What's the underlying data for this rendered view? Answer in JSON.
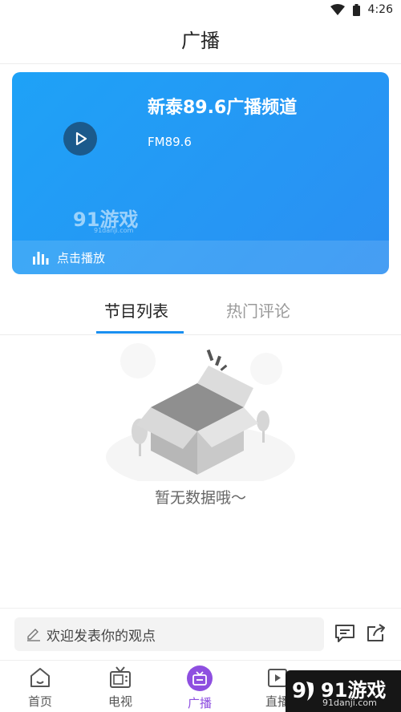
{
  "status_bar": {
    "time": "4:26",
    "icons": [
      "wifi-icon",
      "battery-icon"
    ]
  },
  "header": {
    "title": "广播"
  },
  "player": {
    "channel_name": "新泰89.6广播频道",
    "frequency": "FM89.6",
    "play_label": "点击播放",
    "watermark": "91游戏",
    "watermark_sub": "91danji.com",
    "colors": {
      "card_start": "#1ea2f7",
      "card_end": "#2b8ff2",
      "play_button": "#1b5a8c"
    }
  },
  "tabs": [
    {
      "label": "节目列表",
      "active": true
    },
    {
      "label": "热门评论",
      "active": false
    }
  ],
  "empty_state": {
    "message": "暂无数据哦～",
    "icon": "empty-box-icon"
  },
  "comment_bar": {
    "placeholder": "欢迎发表你的观点",
    "icons": [
      "pencil-icon",
      "chat-icon",
      "share-icon"
    ]
  },
  "nav": [
    {
      "label": "首页",
      "icon": "home-icon",
      "active": false
    },
    {
      "label": "电视",
      "icon": "tv-icon",
      "active": false
    },
    {
      "label": "广播",
      "icon": "radio-icon",
      "active": true
    },
    {
      "label": "直播",
      "icon": "live-icon",
      "active": false
    }
  ],
  "accent_color": "#8e4fe0",
  "tab_accent": "#1a8ff0",
  "corner_watermark": {
    "brand": "91游戏",
    "site": "91danji.com"
  }
}
